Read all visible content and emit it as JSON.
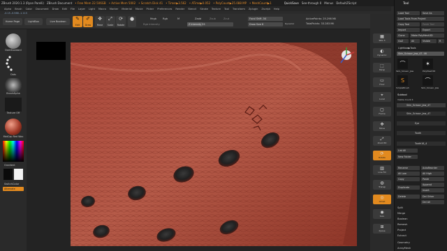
{
  "titlebar": {
    "app": "ZBrush 2020.1.3 (Ryan Parelli)",
    "doc": "ZBrush Document",
    "free_mem": "• Free Mem 22.506GB",
    "active_mem": "• Active Mem 5002",
    "scratch": "• Scratch Disk 41",
    "timer": "• Timer▶3.562",
    "atime": "• ATime▶0.052",
    "polycount": "• PolyCount▶25.088 MP",
    "meshcount": "• MeshCount▶1",
    "quicksave": "QuickSave",
    "seethrough": "See-through 0",
    "menus": "Menus",
    "script": "DefaultZScript"
  },
  "menubar": [
    "Alpha",
    "Brush",
    "Color",
    "Document",
    "Draw",
    "Edit",
    "File",
    "Layer",
    "Light",
    "Macro",
    "Marker",
    "Material",
    "Movie",
    "Picker",
    "Preferences",
    "Render",
    "Stencil",
    "Stroke",
    "Texture",
    "Tool",
    "Transform",
    "Zplugin",
    "Zscript",
    "Help"
  ],
  "coordinates": "-0.15,-0.566,-1.113",
  "toolbar": {
    "home": "Home Page",
    "lightbox": "LightBox",
    "live_boolean": "Live Boolean",
    "edit": "Edit",
    "draw": "Draw",
    "move": "Move",
    "scale": "Scale",
    "rotate": "Rotate",
    "mrgb": "Mrgb",
    "rgb": "Rgb",
    "m": "M",
    "rgb_intensity": "Rgb Intensity",
    "zadd": "Zadd",
    "zsub": "Zsub",
    "zcut": "Zcut",
    "z_intensity": "Z Intensity",
    "z_intensity_value": 33,
    "focal_shift": "Focal Shift",
    "focal_shift_value": -54,
    "draw_size": "Draw Size",
    "draw_size_value": 8,
    "dynamic": "Dynamic",
    "active_points": "ActivePoints: 25.298 Mil",
    "total_points": "TotalPoints: 33.283 Mil"
  },
  "left_shelf": {
    "brush": "DamStandard",
    "stroke": "Dots",
    "alpha": "BrushAlpha",
    "texture": "Texture Off",
    "material": "MatCap Red Wax",
    "gradient": "Gradient",
    "switch_color": "SwitchColor",
    "alternate": "Alternate"
  },
  "right_shelf": [
    "SPix 3",
    "Dynamic",
    "Persp",
    "Floor",
    "Local",
    "Frame",
    "Move",
    "Zoom3D",
    "Rotate",
    "Line Fill",
    "Transp",
    "Ghost",
    "Solo",
    "Xpose"
  ],
  "tool_panel": {
    "title": "Tool",
    "load_tool": "Load Tool",
    "save_as": "Save As",
    "load_from_project": "Load Tools From Project",
    "copy_tool": "Copy Tool",
    "paste_tool": "Paste Tool",
    "import": "Import",
    "export": "Export",
    "clone": "Clone",
    "make_polymesh": "Make PolyMesh3D",
    "goz": "GoZ",
    "all": "All",
    "visible": "Visible",
    "r": "R",
    "lightbox_tools": "Lightbox▶Tools",
    "current_tool": "Skin_Scissor_Jaw_47. 46",
    "tools": [
      "Skin_Scissor_Jaw",
      "PolyMesh3D",
      "SimpleBrush",
      "Skin_Scissor_Jaw"
    ],
    "subtool_header": "Subtool",
    "visible_count": "Visible Count 4",
    "subtools": [
      "Skin_Scissor_Jaw_47",
      "Eye",
      "Tooth",
      "Tooth18_4"
    ],
    "list_all": "List All",
    "new_folder": "New Folder",
    "rename": "Rename",
    "autoreorder": "AutoReorder",
    "all_low": "All Low",
    "all_high": "All High",
    "copy": "Copy",
    "paste": "Paste",
    "append": "Append",
    "duplicate": "Duplicate",
    "insert": "Insert",
    "delete": "Delete",
    "del_other": "Del Other",
    "del_all": "Del All",
    "split": "Split",
    "merge": "Merge",
    "boolean": "Boolean",
    "remesh": "Remesh",
    "project": "Project",
    "extract": "Extract",
    "geometry": "Geometry",
    "arraymesh": "ArrayMesh"
  },
  "colors": {
    "accent": "#e28a1f",
    "skin": "#b0503e",
    "background": "#2b2b2b"
  },
  "icons": [
    "home-icon",
    "edit-icon",
    "draw-icon",
    "move-icon",
    "scale-icon",
    "rotate-icon",
    "sphere-icon",
    "gizmo-icon"
  ]
}
